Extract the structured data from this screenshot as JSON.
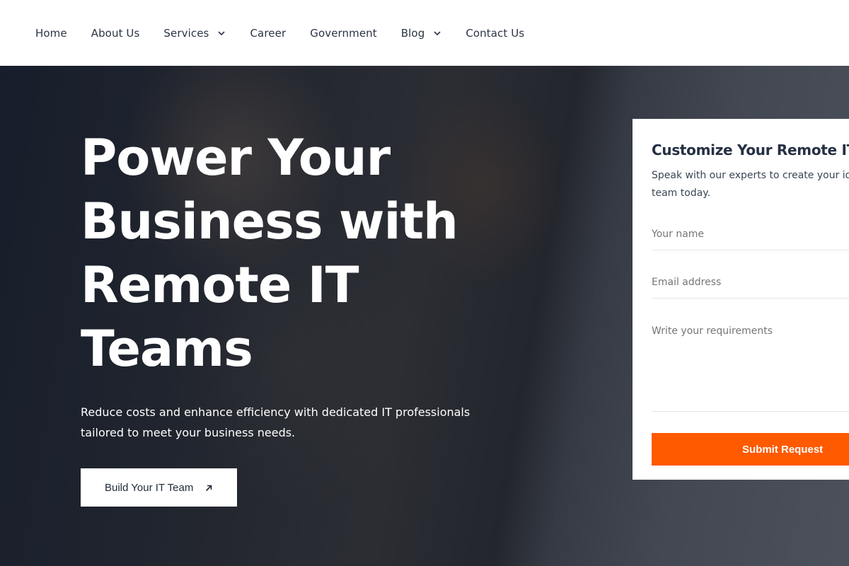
{
  "nav": {
    "items": [
      {
        "label": "Home",
        "has_dropdown": false
      },
      {
        "label": "About Us",
        "has_dropdown": false
      },
      {
        "label": "Services",
        "has_dropdown": true
      },
      {
        "label": "Career",
        "has_dropdown": false
      },
      {
        "label": "Government",
        "has_dropdown": false
      },
      {
        "label": "Blog",
        "has_dropdown": true
      },
      {
        "label": "Contact Us",
        "has_dropdown": false
      }
    ]
  },
  "hero": {
    "title": "Power Your Business with Remote IT Teams",
    "subtitle": "Reduce costs and enhance efficiency with dedicated IT professionals tailored to meet your business needs.",
    "cta_label": "Build Your IT Team",
    "cta_icon": "arrow-up-right-icon"
  },
  "form": {
    "title": "Customize Your Remote IT Te",
    "subtitle": "Speak with our experts to create your id IT team today.",
    "name_placeholder": "Your name",
    "email_placeholder": "Email address",
    "requirements_placeholder": "Write your requirements",
    "submit_label": "Submit Request"
  },
  "colors": {
    "accent": "#ff5a00",
    "nav_bg": "#ffffff",
    "text_dark": "#1f2a37"
  }
}
